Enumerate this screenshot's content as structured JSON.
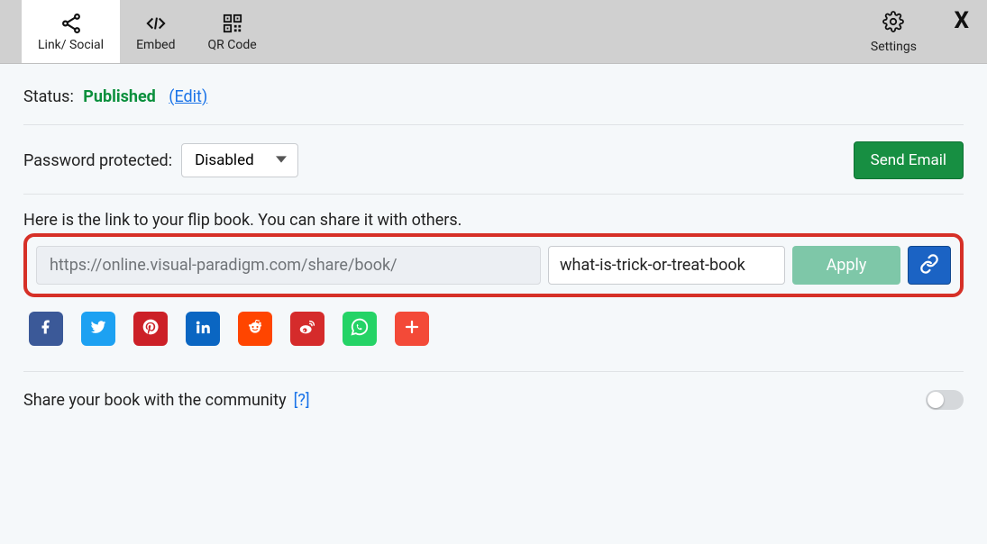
{
  "tabs": {
    "link_social": "Link/ Social",
    "embed": "Embed",
    "qr": "QR Code"
  },
  "settings_label": "Settings",
  "status": {
    "label": "Status:",
    "value": "Published",
    "edit": "(Edit)"
  },
  "password": {
    "label": "Password protected:",
    "value": "Disabled"
  },
  "send_email": "Send Email",
  "link_instruction": "Here is the link to your flip book. You can share it with others.",
  "url_prefix": "https://online.visual-paradigm.com/share/book/",
  "url_slug": "what-is-trick-or-treat-book",
  "apply": "Apply",
  "share_community": {
    "label": "Share your book with the community",
    "help": "[?]"
  }
}
